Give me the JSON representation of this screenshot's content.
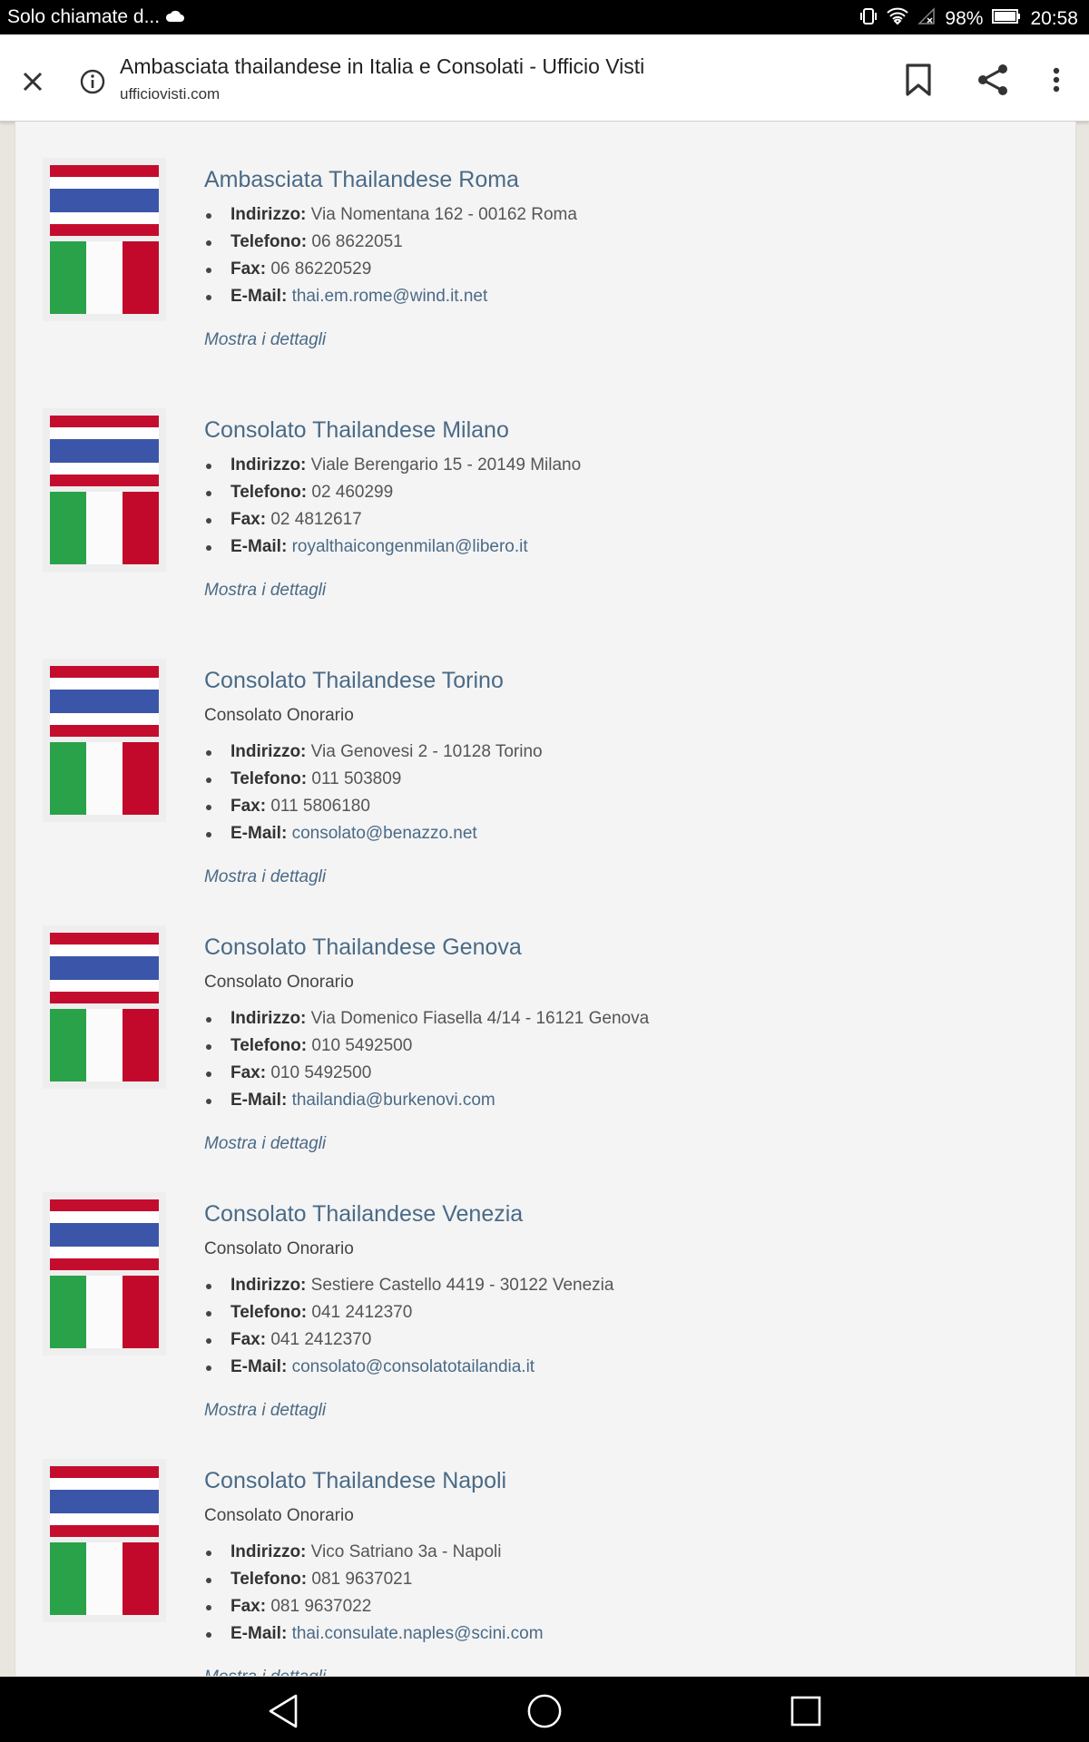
{
  "statusbar": {
    "left_text": "Solo chiamate d...",
    "battery": "98%",
    "time": "20:58"
  },
  "toolbar": {
    "title": "Ambasciata thailandese in Italia e Consolati - Ufficio Visti",
    "url": "ufficiovisti.com"
  },
  "labels": {
    "address": "Indirizzo:",
    "phone": "Telefono:",
    "fax": "Fax:",
    "email": "E-Mail:",
    "more": "Mostra i dettagli"
  },
  "colors": {
    "thai_red": "#c40d2e",
    "thai_white": "#ffffff",
    "thai_blue": "#3b56a8",
    "it_green": "#2aa24a",
    "it_white": "#fbfbfb",
    "it_red": "#c2092b",
    "link": "#4a6a86"
  },
  "entries": [
    {
      "title": "Ambasciata Thailandese Roma",
      "subtitle": "",
      "address": " Via Nomentana 162 - 00162 Roma",
      "phone": " 06 8622051",
      "fax": " 06 86220529",
      "email": "thai.em.rome@wind.it.net"
    },
    {
      "title": "Consolato Thailandese Milano",
      "subtitle": "",
      "address": " Viale Berengario 15 - 20149 Milano",
      "phone": " 02 460299",
      "fax": " 02 4812617",
      "email": "royalthaicongenmilan@libero.it"
    },
    {
      "title": "Consolato Thailandese Torino",
      "subtitle": "Consolato Onorario",
      "address": " Via Genovesi 2 - 10128 Torino",
      "phone": " 011 503809",
      "fax": " 011 5806180",
      "email": "consolato@benazzo.net"
    },
    {
      "title": "Consolato Thailandese Genova",
      "subtitle": "Consolato Onorario",
      "address": " Via Domenico Fiasella 4/14 - 16121 Genova",
      "phone": " 010 5492500",
      "fax": " 010 5492500",
      "email": "thailandia@burkenovi.com"
    },
    {
      "title": "Consolato Thailandese Venezia",
      "subtitle": "Consolato Onorario",
      "address": " Sestiere Castello 4419 - 30122 Venezia",
      "phone": " 041 2412370",
      "fax": " 041 2412370",
      "email": "consolato@consolatotailandia.it"
    },
    {
      "title": "Consolato Thailandese Napoli",
      "subtitle": "Consolato Onorario",
      "address": " Vico Satriano 3a - Napoli",
      "phone": " 081 9637021",
      "fax": " 081 9637022",
      "email": "thai.consulate.naples@scini.com"
    }
  ]
}
